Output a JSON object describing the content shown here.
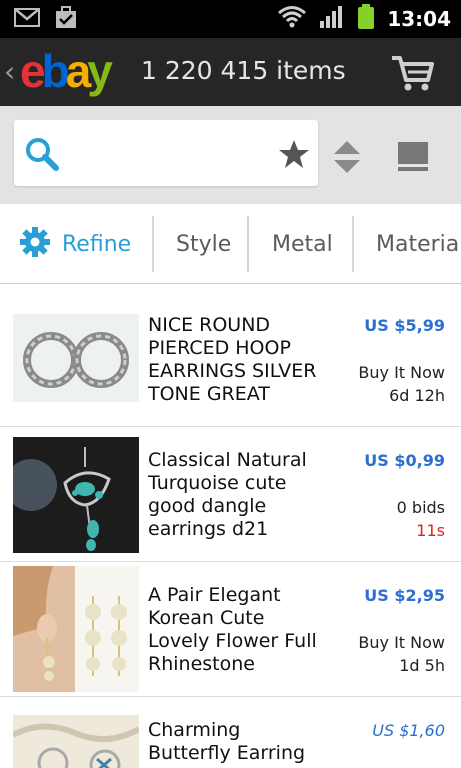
{
  "status_bar": {
    "time": "13:04",
    "icons": [
      "gmail-icon",
      "download-done-icon",
      "wifi-icon",
      "signal-icon",
      "battery-icon"
    ]
  },
  "header": {
    "back_glyph": "‹",
    "logo_letters": [
      "e",
      "b",
      "a",
      "y"
    ],
    "item_count": "1 220 415 items",
    "cart_icon": "cart-icon"
  },
  "search": {
    "value": "",
    "search_icon": "search-icon",
    "star_icon": "star-icon",
    "sort_icon": "sort-icon",
    "view_icon": "view-mode-icon"
  },
  "refine": {
    "refine_label": "Refine",
    "tabs": [
      "Style",
      "Metal",
      "Material"
    ]
  },
  "colors": {
    "accent": "#2a9fd6",
    "price": "#2a6fcf",
    "urgent": "#e0201b",
    "header_bg": "#262626"
  },
  "listings": [
    {
      "title": "NICE  ROUND PIERCED HOOP EARRINGS SILVER TONE GREAT",
      "price": "US $5,99",
      "format": "Buy It Now",
      "time_left": "6d 12h"
    },
    {
      "title": "Classical Natural Turquoise cute good dangle earrings d21",
      "price": "US $0,99",
      "format": "0 bids",
      "time_left": "11s"
    },
    {
      "title": "A Pair Elegant Korean Cute Lovely Flower Full Rhinestone",
      "price": "US $2,95",
      "format": "Buy It Now",
      "time_left": "1d 5h"
    },
    {
      "title": "Charming Butterfly Earring",
      "price": "US $1,60",
      "format": "",
      "time_left": ""
    }
  ]
}
